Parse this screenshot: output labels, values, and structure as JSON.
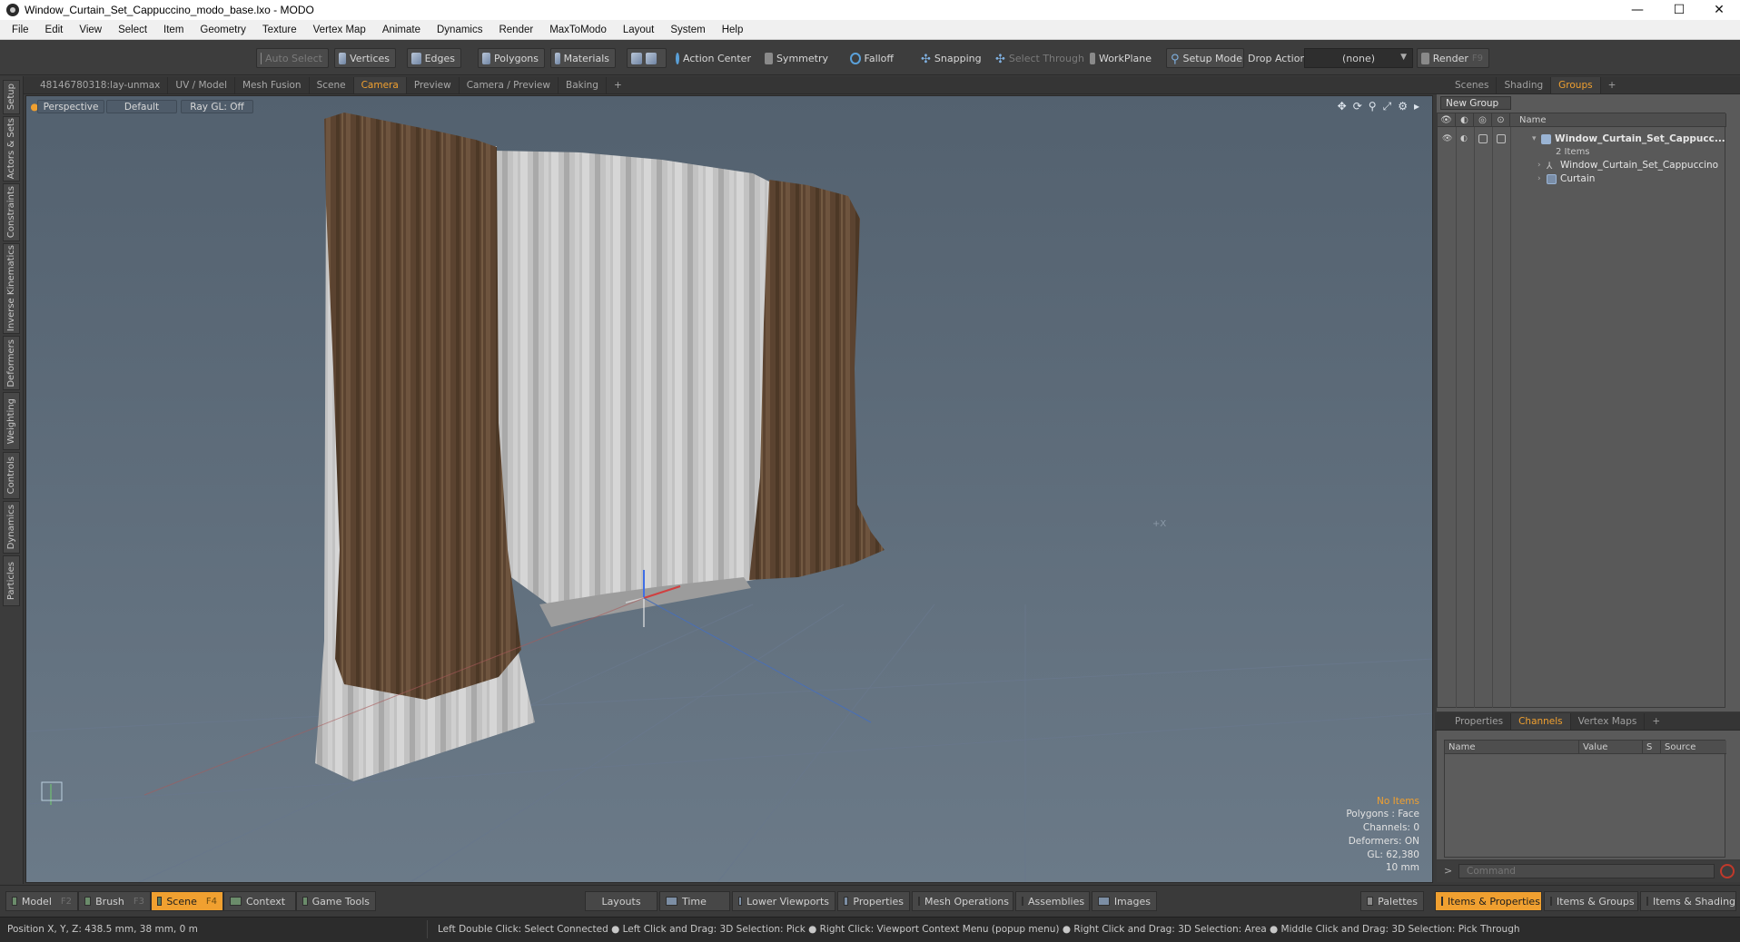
{
  "window": {
    "title": "Window_Curtain_Set_Cappuccino_modo_base.lxo - MODO",
    "minimize": "—",
    "maximize": "☐",
    "close": "✕"
  },
  "menu": [
    "File",
    "Edit",
    "View",
    "Select",
    "Item",
    "Geometry",
    "Texture",
    "Vertex Map",
    "Animate",
    "Dynamics",
    "Render",
    "MaxToModo",
    "Layout",
    "System",
    "Help"
  ],
  "toolbar": {
    "auto_select": "Auto Select",
    "vertices": "Vertices",
    "edges": "Edges",
    "polygons": "Polygons",
    "materials": "Materials",
    "action_center": "Action Center",
    "symmetry": "Symmetry",
    "falloff": "Falloff",
    "snapping": "Snapping",
    "select_through": "Select Through",
    "workplane": "WorkPlane",
    "setup_mode": "Setup Mode",
    "drop_action": "Drop Action",
    "drop_value": "(none)",
    "render": "Render",
    "render_key": "F9"
  },
  "left_tabs": [
    "Setup",
    "Actors & Sets",
    "Constraints",
    "Inverse Kinematics",
    "Deformers",
    "Weighting",
    "Controls",
    "Dynamics",
    "Particles"
  ],
  "viewport_tabs": [
    "48146780318:lay-unmax",
    "UV / Model",
    "Mesh Fusion",
    "Scene",
    "Camera",
    "Preview",
    "Camera / Preview",
    "Baking",
    "+"
  ],
  "viewport_active_tab": "Camera",
  "viewport": {
    "view_mode": "Perspective",
    "shading": "Default",
    "raygl": "Ray GL: Off",
    "info": {
      "items": "No Items",
      "polygons": "Polygons : Face",
      "channels": "Channels: 0",
      "deformers": "Deformers: ON",
      "gl": "GL: 62,380",
      "scale": "10 mm"
    },
    "axis_marker": "+X"
  },
  "right_top_tabs": [
    "Scenes",
    "Shading",
    "Groups",
    "+"
  ],
  "right_top_active": "Groups",
  "groups": {
    "new_group": "New Group",
    "name_header": "Name",
    "root": "Window_Curtain_Set_Cappucc...",
    "root_count": "2 Items",
    "children": [
      "Window_Curtain_Set_Cappuccino",
      "Curtain"
    ]
  },
  "right_mid_tabs": [
    "Properties",
    "Channels",
    "Vertex Maps",
    "+"
  ],
  "right_mid_active": "Channels",
  "channels": {
    "headers": [
      "Name",
      "Value",
      "S",
      "Source"
    ],
    "command_placeholder": "Command",
    "command_prompt": ">"
  },
  "bottom_left": [
    {
      "label": "Model",
      "key": "F2"
    },
    {
      "label": "Brush",
      "key": "F3"
    },
    {
      "label": "Scene",
      "key": "F4"
    },
    {
      "label": "Context",
      "key": ""
    },
    {
      "label": "Game Tools",
      "key": ""
    }
  ],
  "bottom_active": "Scene",
  "bottom_center": [
    "Layouts",
    "Time",
    "Lower Viewports",
    "Properties",
    "Mesh Operations",
    "Assemblies",
    "Images"
  ],
  "bottom_right": [
    "Palettes",
    "Items & Properties",
    "Items & Groups",
    "Items & Shading"
  ],
  "bottom_right_active": "Items & Properties",
  "status": {
    "position": "Position X, Y, Z:   438.5 mm, 38 mm, 0 m",
    "hint": "Left Double Click: Select Connected ● Left Click and Drag: 3D Selection: Pick ● Right Click: Viewport Context Menu (popup menu) ● Right Click and Drag: 3D Selection: Area ● Middle Click and Drag: 3D Selection: Pick Through"
  },
  "colors": {
    "accent": "#f0a030",
    "viewport_bg": "#5d6d7e",
    "curtain_brown": "#5e4632",
    "curtain_white": "#c9c9c9"
  }
}
